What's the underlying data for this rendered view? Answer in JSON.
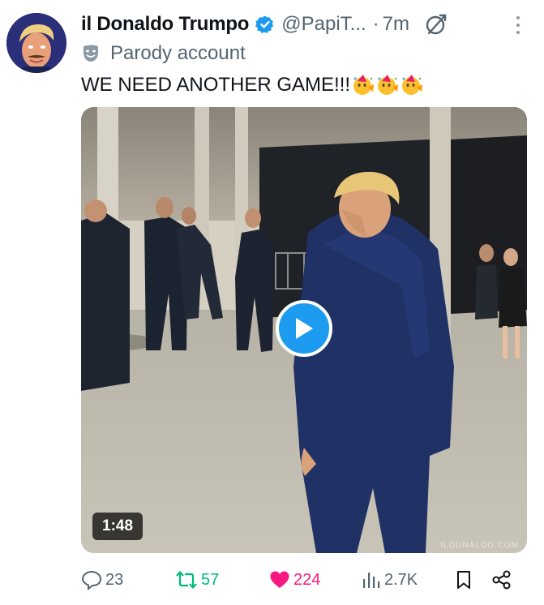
{
  "post": {
    "author_name": "il Donaldo Trumpo",
    "handle": "@PapiT...",
    "separator": "·",
    "time": "7m",
    "label": "Parody account",
    "text": "WE NEED ANOTHER GAME!!!",
    "emoji": [
      "face-with-party-horn",
      "face-with-party-horn",
      "face-with-party-horn"
    ]
  },
  "media": {
    "type": "video",
    "duration": "1:48",
    "watermark": "ILDONALDO.COM"
  },
  "actions": {
    "replies": "23",
    "reposts": "57",
    "likes": "224",
    "views": "2.7K"
  },
  "colors": {
    "verified_blue": "#1d9bf0",
    "repost_green": "#00ba7c",
    "like_pink": "#f91880",
    "muted_gray": "#536471"
  }
}
